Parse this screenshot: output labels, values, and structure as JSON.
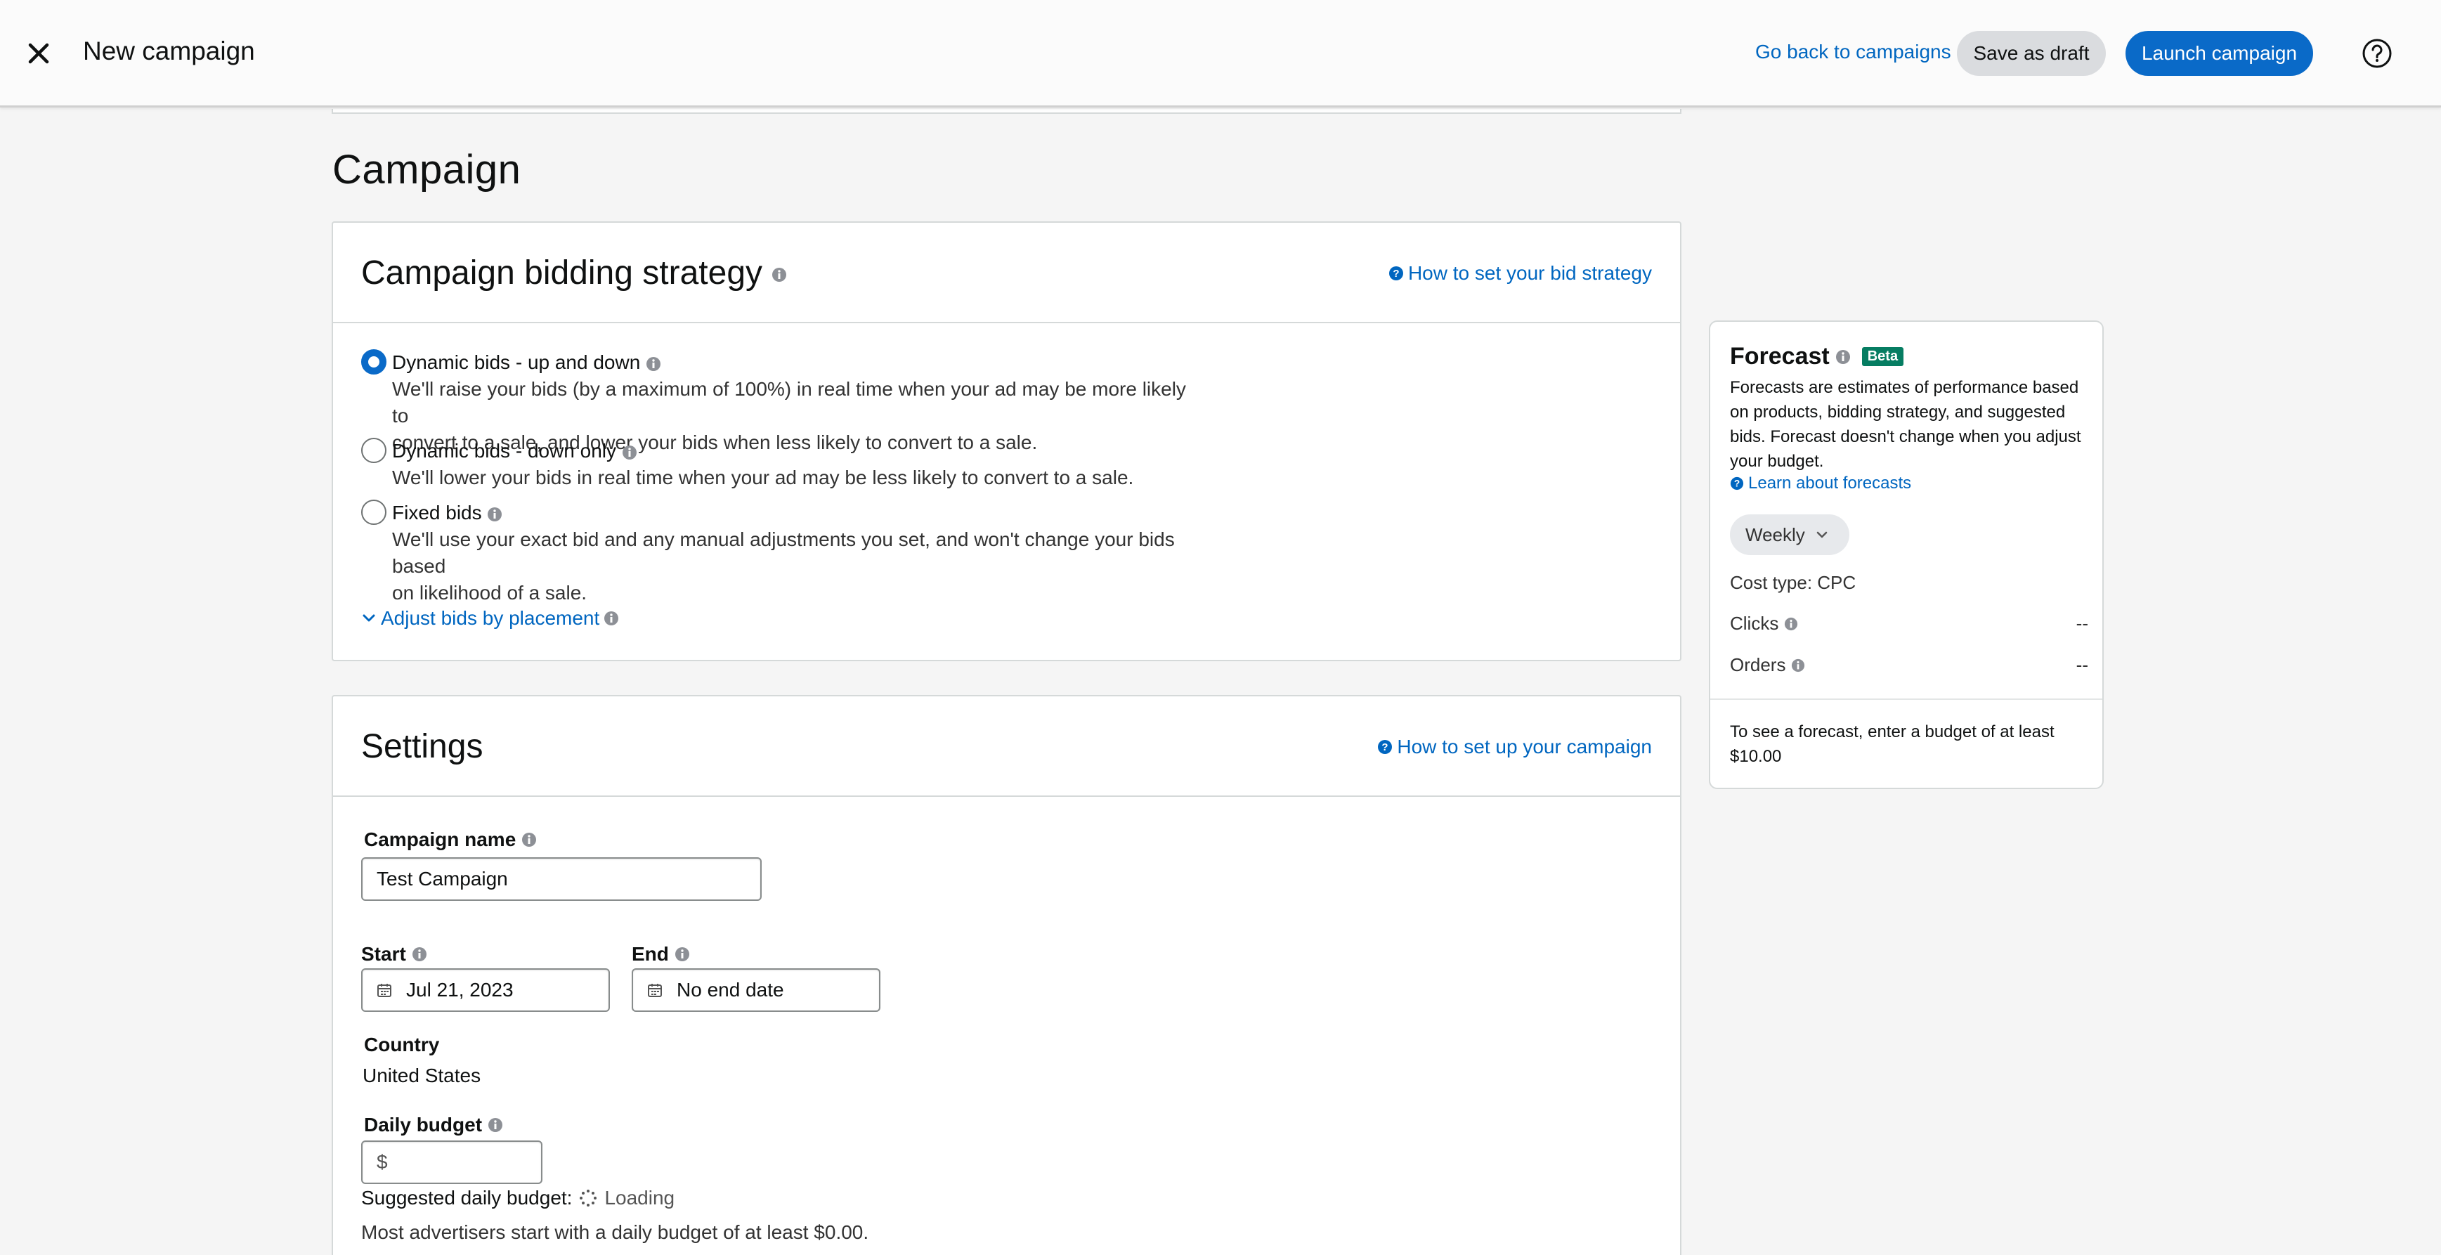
{
  "header": {
    "title": "New campaign",
    "back_link": "Go back to campaigns",
    "save_draft_label": "Save as draft",
    "launch_label": "Launch campaign"
  },
  "page": {
    "section_title": "Campaign"
  },
  "bidding": {
    "title": "Campaign bidding strategy",
    "help_link": "How to set your bid strategy",
    "options": [
      {
        "label": "Dynamic bids - up and down",
        "description_lines": [
          "We'll raise your bids (by a maximum of 100%) in real time when your ad may be more likely to",
          "convert to a sale, and lower your bids when less likely to convert to a sale."
        ],
        "selected": true
      },
      {
        "label": "Dynamic bids - down only",
        "description_lines": [
          "We'll lower your bids in real time when your ad may be less likely to convert to a sale."
        ],
        "selected": false
      },
      {
        "label": "Fixed bids",
        "description_lines": [
          "We'll use your exact bid and any manual adjustments you set, and won't change your bids based",
          "on likelihood of a sale."
        ],
        "selected": false
      }
    ],
    "adjust_link": "Adjust bids by placement"
  },
  "settings": {
    "title": "Settings",
    "help_link": "How to set up your campaign",
    "campaign_name_label": "Campaign name",
    "campaign_name_value": "Test Campaign",
    "start_label": "Start",
    "start_value": "Jul 21, 2023",
    "end_label": "End",
    "end_value": "No end date",
    "country_label": "Country",
    "country_value": "United States",
    "daily_budget_label": "Daily budget",
    "daily_budget_prefix": "$",
    "suggested_label": "Suggested daily budget:",
    "suggested_status": "Loading",
    "advice": "Most advertisers start with a daily budget of at least $0.00."
  },
  "forecast": {
    "title": "Forecast",
    "badge": "Beta",
    "description": "Forecasts are estimates of performance based on products, bidding strategy, and suggested bids. Forecast doesn't change when you adjust your budget.",
    "learn_link": "Learn about forecasts",
    "period": "Weekly",
    "cost_type": "Cost type: CPC",
    "clicks_label": "Clicks",
    "clicks_value": "--",
    "orders_label": "Orders",
    "orders_value": "--",
    "note": "To see a forecast, enter a budget of at least $10.00"
  },
  "colors": {
    "accent": "#0a6ac8",
    "link": "#0066c0",
    "beta": "#067d62"
  }
}
